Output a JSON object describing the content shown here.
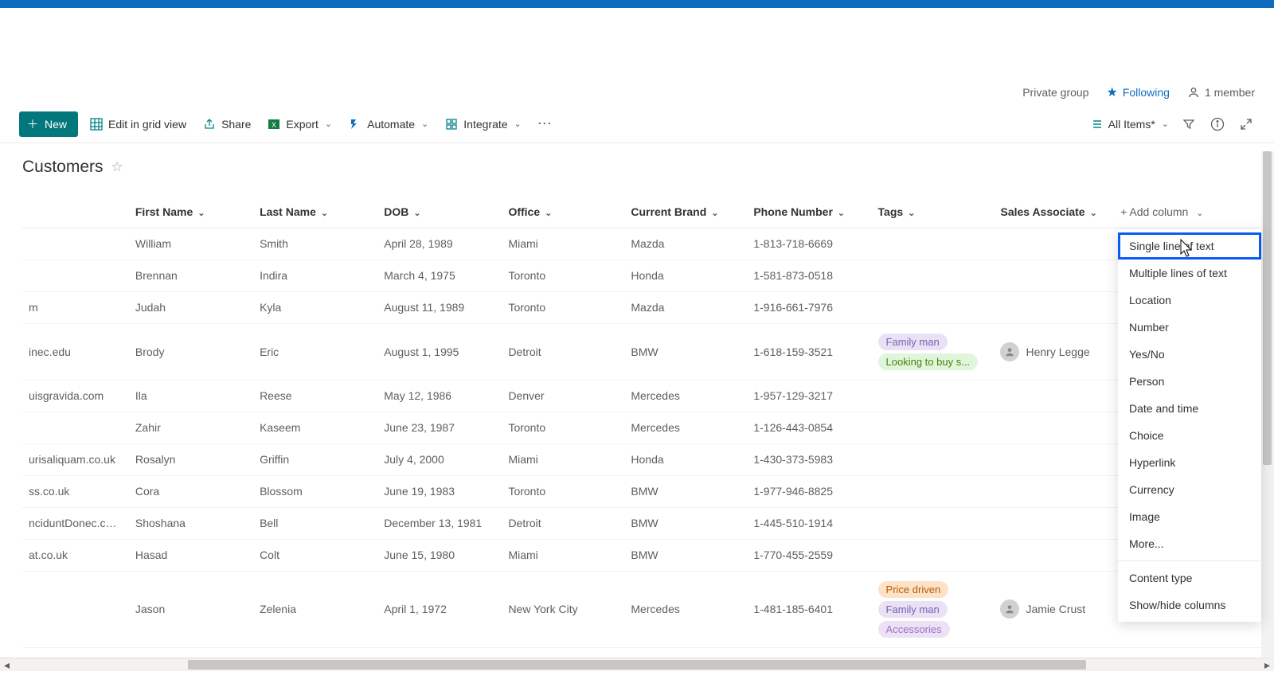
{
  "header": {
    "private_group": "Private group",
    "following": "Following",
    "members": "1 member"
  },
  "toolbar": {
    "new": "New",
    "grid": "Edit in grid view",
    "share": "Share",
    "export": "Export",
    "automate": "Automate",
    "integrate": "Integrate",
    "view": "All Items*"
  },
  "list": {
    "title": "Customers"
  },
  "columns": {
    "first": "First Name",
    "last": "Last Name",
    "dob": "DOB",
    "office": "Office",
    "brand": "Current Brand",
    "phone": "Phone Number",
    "tags": "Tags",
    "assoc": "Sales Associate",
    "add": "Add column"
  },
  "rows": [
    {
      "email": "",
      "first": "William",
      "last": "Smith",
      "dob": "April 28, 1989",
      "office": "Miami",
      "brand": "Mazda",
      "phone": "1-813-718-6669",
      "tags": [],
      "assoc": ""
    },
    {
      "email": "",
      "first": "Brennan",
      "last": "Indira",
      "dob": "March 4, 1975",
      "office": "Toronto",
      "brand": "Honda",
      "phone": "1-581-873-0518",
      "tags": [],
      "assoc": ""
    },
    {
      "email": "m",
      "first": "Judah",
      "last": "Kyla",
      "dob": "August 11, 1989",
      "office": "Toronto",
      "brand": "Mazda",
      "phone": "1-916-661-7976",
      "tags": [],
      "assoc": ""
    },
    {
      "email": "inec.edu",
      "first": "Brody",
      "last": "Eric",
      "dob": "August 1, 1995",
      "office": "Detroit",
      "brand": "BMW",
      "phone": "1-618-159-3521",
      "tags": [
        {
          "t": "Family man",
          "c": "purple"
        },
        {
          "t": "Looking to buy s...",
          "c": "green"
        }
      ],
      "assoc": "Henry Legge"
    },
    {
      "email": "uisgravida.com",
      "first": "Ila",
      "last": "Reese",
      "dob": "May 12, 1986",
      "office": "Denver",
      "brand": "Mercedes",
      "phone": "1-957-129-3217",
      "tags": [],
      "assoc": ""
    },
    {
      "email": "",
      "first": "Zahir",
      "last": "Kaseem",
      "dob": "June 23, 1987",
      "office": "Toronto",
      "brand": "Mercedes",
      "phone": "1-126-443-0854",
      "tags": [],
      "assoc": ""
    },
    {
      "email": "urisaliquam.co.uk",
      "first": "Rosalyn",
      "last": "Griffin",
      "dob": "July 4, 2000",
      "office": "Miami",
      "brand": "Honda",
      "phone": "1-430-373-5983",
      "tags": [],
      "assoc": ""
    },
    {
      "email": "ss.co.uk",
      "first": "Cora",
      "last": "Blossom",
      "dob": "June 19, 1983",
      "office": "Toronto",
      "brand": "BMW",
      "phone": "1-977-946-8825",
      "tags": [],
      "assoc": ""
    },
    {
      "email": "nciduntDonec.co.uk",
      "first": "Shoshana",
      "last": "Bell",
      "dob": "December 13, 1981",
      "office": "Detroit",
      "brand": "BMW",
      "phone": "1-445-510-1914",
      "tags": [],
      "assoc": ""
    },
    {
      "email": "at.co.uk",
      "first": "Hasad",
      "last": "Colt",
      "dob": "June 15, 1980",
      "office": "Miami",
      "brand": "BMW",
      "phone": "1-770-455-2559",
      "tags": [],
      "assoc": ""
    },
    {
      "email": "",
      "first": "Jason",
      "last": "Zelenia",
      "dob": "April 1, 1972",
      "office": "New York City",
      "brand": "Mercedes",
      "phone": "1-481-185-6401",
      "tags": [
        {
          "t": "Price driven",
          "c": "orange"
        },
        {
          "t": "Family man",
          "c": "purple"
        },
        {
          "t": "Accessories",
          "c": "lilac"
        }
      ],
      "assoc": "Jamie Crust"
    }
  ],
  "dropdown": {
    "items": [
      "Single line of text",
      "Multiple lines of text",
      "Location",
      "Number",
      "Yes/No",
      "Person",
      "Date and time",
      "Choice",
      "Hyperlink",
      "Currency",
      "Image",
      "More..."
    ],
    "extra": [
      "Content type",
      "Show/hide columns"
    ],
    "highlight_index": 0
  }
}
